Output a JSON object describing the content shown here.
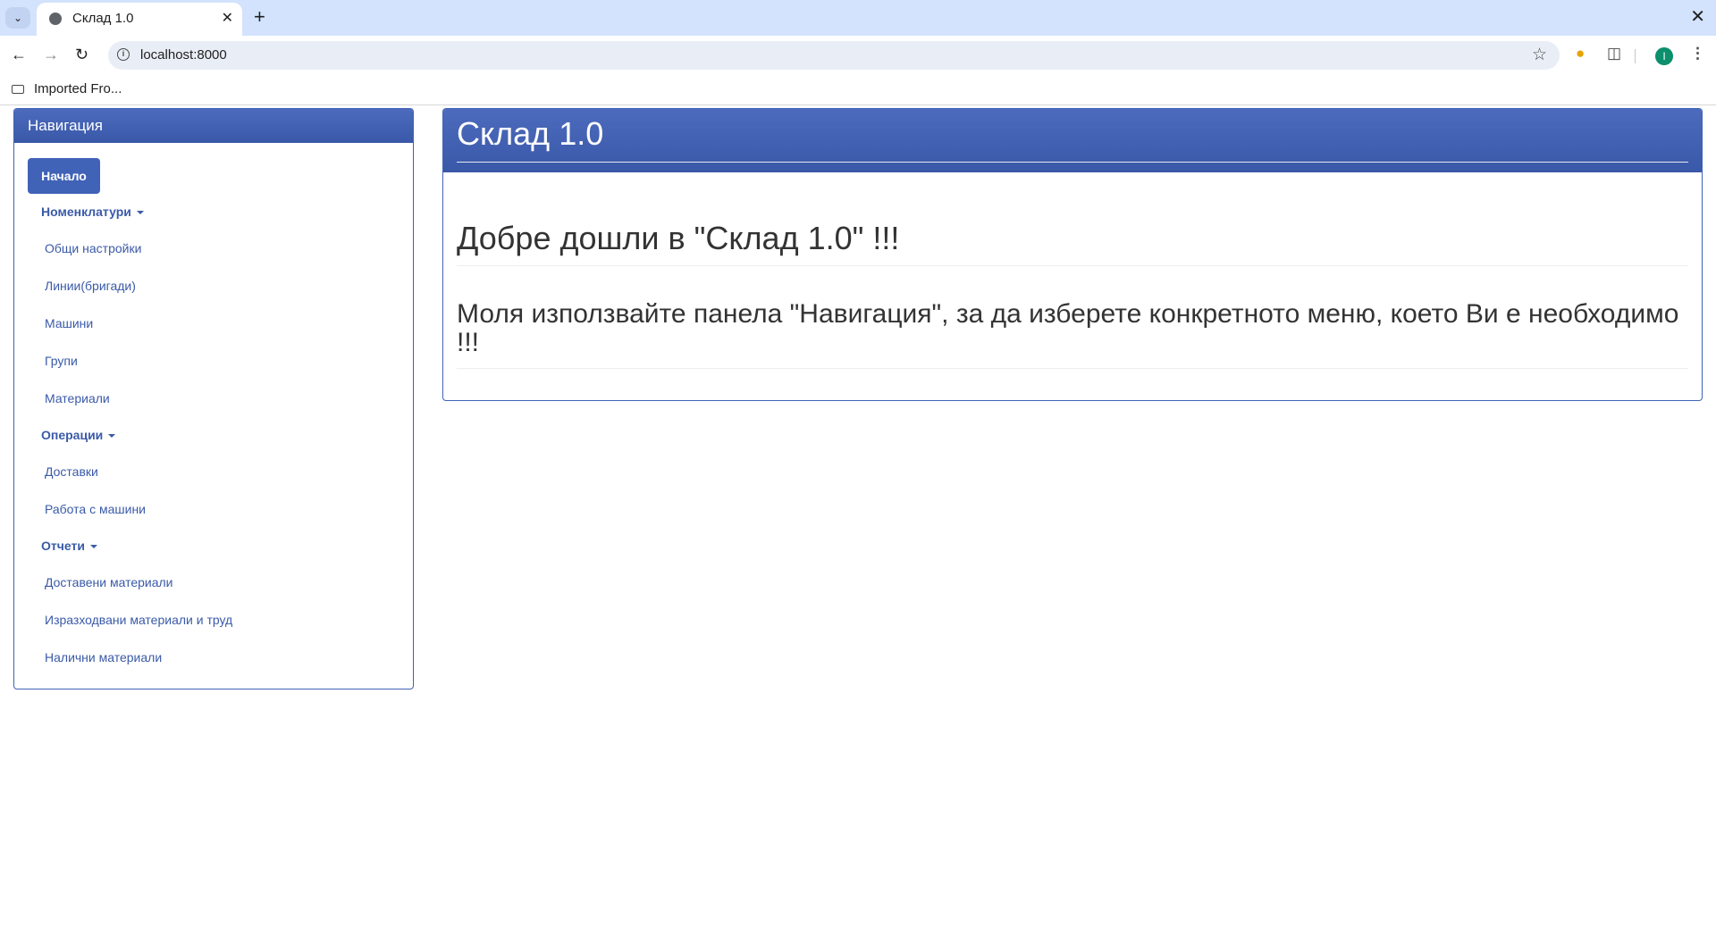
{
  "browser": {
    "tab_title": "Склад 1.0",
    "url": "localhost:8000",
    "bookmark": "Imported Fro...",
    "profile_initial": "I"
  },
  "nav": {
    "heading": "Навигация",
    "home": "Начало",
    "groups": [
      {
        "label": "Номенклатури",
        "items": [
          "Общи настройки",
          "Линии(бригади)",
          "Машини",
          "Групи",
          "Материали"
        ]
      },
      {
        "label": "Операции",
        "items": [
          "Доставки",
          "Работа с машини"
        ]
      },
      {
        "label": "Отчети",
        "items": [
          "Доставени материали",
          "Изразходвани материали и труд",
          "Налични материали"
        ]
      }
    ]
  },
  "main": {
    "heading": "Склад 1.0",
    "welcome": "Добре дошли в \"Склад 1.0\" !!!",
    "instruction": "Моля използвайте панела \"Навигация\", за да изберете конкретното меню, което Ви е необходимо !!!"
  }
}
